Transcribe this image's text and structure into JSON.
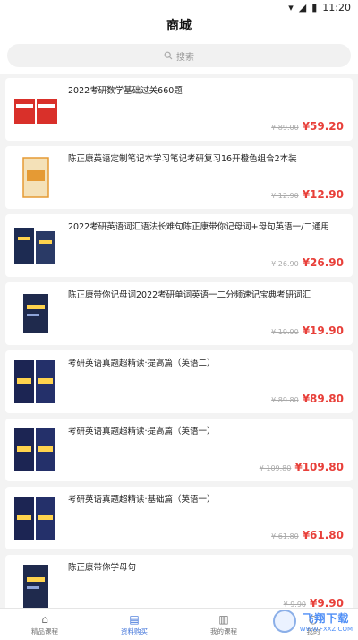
{
  "status": {
    "time": "11:20"
  },
  "header": {
    "title": "商城"
  },
  "search": {
    "placeholder": "搜索"
  },
  "products": [
    {
      "title": "2022考研数学基础过关660题",
      "old_price": "¥ 89.00",
      "price": "¥59.20",
      "cover_color": "#d9302a"
    },
    {
      "title": "陈正康英语定制笔记本学习笔记考研复习16开橙色组合2本装",
      "old_price": "¥ 12.90",
      "price": "¥12.90",
      "cover_color": "#e59a34"
    },
    {
      "title": "2022考研英语词汇语法长难句陈正康带你记母词+母句英语一/二通用",
      "old_price": "¥ 26.90",
      "price": "¥26.90",
      "cover_color": "#1d2b52"
    },
    {
      "title": "陈正康带你记母词2022考研单词英语一二分频速记宝典考研词汇",
      "old_price": "¥ 19.90",
      "price": "¥19.90",
      "cover_color": "#1f2a4d"
    },
    {
      "title": "考研英语真题超精读·提高篇（英语二）",
      "old_price": "¥ 89.80",
      "price": "¥89.80",
      "cover_color": "#1c2553"
    },
    {
      "title": "考研英语真题超精读·提高篇（英语一）",
      "old_price": "¥ 109.80",
      "price": "¥109.80",
      "cover_color": "#1c2553"
    },
    {
      "title": "考研英语真题超精读·基础篇（英语一）",
      "old_price": "¥ 61.80",
      "price": "¥61.80",
      "cover_color": "#1c2553"
    },
    {
      "title": "陈正康带你学母句",
      "old_price": "¥ 9.90",
      "price": "¥9.90",
      "cover_color": "#1f2a4d"
    }
  ],
  "tabbar": {
    "tabs": [
      {
        "label": "精品课程",
        "icon": "home-icon"
      },
      {
        "label": "资料购买",
        "icon": "book-icon",
        "active": true
      },
      {
        "label": "我的课程",
        "icon": "courses-icon"
      },
      {
        "label": "我的",
        "icon": "user-icon"
      }
    ]
  },
  "watermark": {
    "text": "飞翔下载",
    "url": "WWW.FXXZ.COM"
  }
}
